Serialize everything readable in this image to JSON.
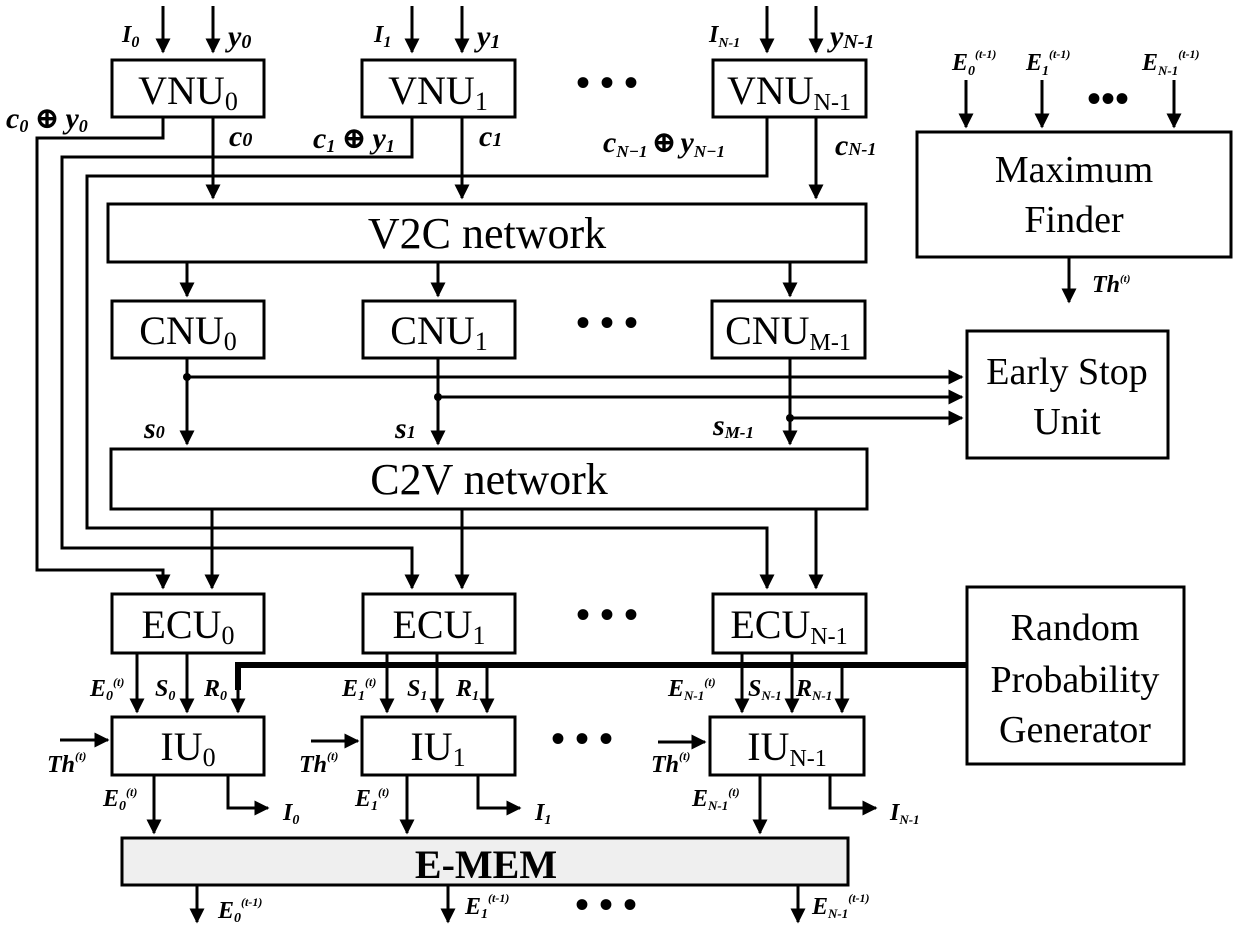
{
  "title": "Decoder architecture block diagram",
  "blocks": {
    "vnu": [
      {
        "base": "VNU",
        "sub": "0"
      },
      {
        "base": "VNU",
        "sub": "1"
      },
      {
        "base": "VNU",
        "sub": "N-1"
      }
    ],
    "cnu": [
      {
        "base": "CNU",
        "sub": "0"
      },
      {
        "base": "CNU",
        "sub": "1"
      },
      {
        "base": "CNU",
        "sub": "M-1"
      }
    ],
    "ecu": [
      {
        "base": "ECU",
        "sub": "0"
      },
      {
        "base": "ECU",
        "sub": "1"
      },
      {
        "base": "ECU",
        "sub": "N-1"
      }
    ],
    "iu": [
      {
        "base": "IU",
        "sub": "0"
      },
      {
        "base": "IU",
        "sub": "1"
      },
      {
        "base": "IU",
        "sub": "N-1"
      }
    ],
    "v2c": "V2C network",
    "c2v": "C2V network",
    "max_finder": [
      "Maximum",
      "Finder"
    ],
    "early_stop": [
      "Early Stop",
      "Unit"
    ],
    "rpg": [
      "Random",
      "Probability",
      "Generator"
    ],
    "emem": "E-MEM"
  },
  "ellipsis": "• • •",
  "ellipsis_small": "•••",
  "signals": {
    "vnu_inputs": [
      {
        "I": "I",
        "Isub": "0",
        "y": "y",
        "ysub": "0"
      },
      {
        "I": "I",
        "Isub": "1",
        "y": "y",
        "ysub": "1"
      },
      {
        "I": "I",
        "Isub": "N-1",
        "y": "y",
        "ysub": "N-1"
      }
    ],
    "vnu_xor": [
      {
        "c": "c",
        "csub": "0",
        "op": "⊕",
        "y": "y",
        "ysub": "0"
      },
      {
        "c": "c",
        "csub": "1",
        "op": "⊕",
        "y": "y",
        "ysub": "1"
      },
      {
        "c": "c",
        "csub": "N−1",
        "op": "⊕",
        "y": "y",
        "ysub": "N−1"
      }
    ],
    "vnu_c": [
      {
        "base": "c",
        "sub": "0"
      },
      {
        "base": "c",
        "sub": "1"
      },
      {
        "base": "c",
        "sub": "N-1"
      }
    ],
    "cnu_s": [
      {
        "base": "s",
        "sub": "0"
      },
      {
        "base": "s",
        "sub": "1"
      },
      {
        "base": "s",
        "sub": "M-1"
      }
    ],
    "max_inputs": [
      {
        "base": "E",
        "sub": "0",
        "sup": "(t-1)"
      },
      {
        "base": "E",
        "sub": "1",
        "sup": "(t-1)"
      },
      {
        "base": "E",
        "sub": "N-1",
        "sup": "(t-1)"
      }
    ],
    "th_out": {
      "base": "Th",
      "sup": "(t)"
    },
    "ecu_out": [
      {
        "E": "E",
        "Esub": "0",
        "Esup": "(t)",
        "S": "S",
        "Ssub": "0",
        "R": "R",
        "Rsub": "0"
      },
      {
        "E": "E",
        "Esub": "1",
        "Esup": "(t)",
        "S": "S",
        "Ssub": "1",
        "R": "R",
        "Rsub": "1"
      },
      {
        "E": "E",
        "Esub": "N-1",
        "Esup": "(t)",
        "S": "S",
        "Ssub": "N-1",
        "R": "R",
        "Rsub": "N-1"
      }
    ],
    "iu_th": {
      "base": "Th",
      "sup": "(t)"
    },
    "iu_E_out": [
      {
        "base": "E",
        "sub": "0",
        "sup": "(t)"
      },
      {
        "base": "E",
        "sub": "1",
        "sup": "(t)"
      },
      {
        "base": "E",
        "sub": "N-1",
        "sup": "(t)"
      }
    ],
    "iu_I_out": [
      {
        "base": "I",
        "sub": "0"
      },
      {
        "base": "I",
        "sub": "1"
      },
      {
        "base": "I",
        "sub": "N-1"
      }
    ],
    "emem_out": [
      {
        "base": "E",
        "sub": "0",
        "sup": "(t-1)"
      },
      {
        "base": "E",
        "sub": "1",
        "sup": "(t-1)"
      },
      {
        "base": "E",
        "sub": "N-1",
        "sup": "(t-1)"
      }
    ]
  }
}
